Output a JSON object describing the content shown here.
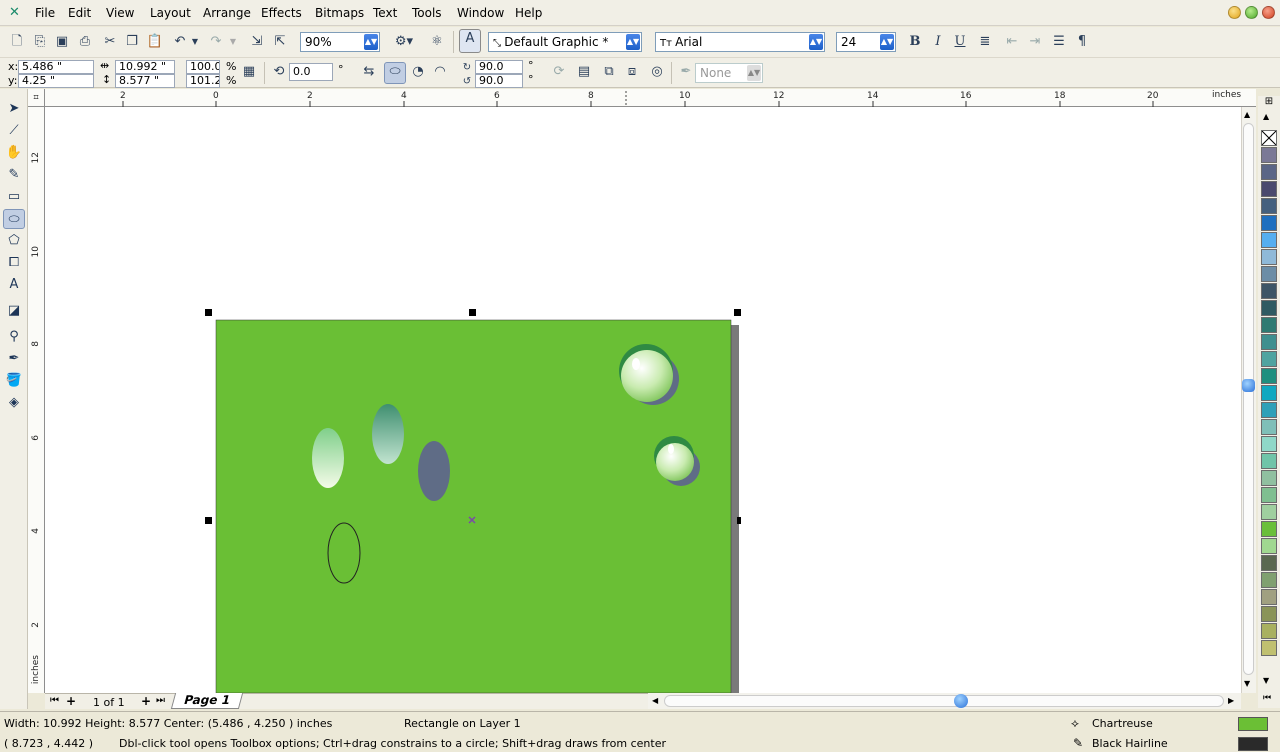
{
  "menu": [
    "File",
    "Edit",
    "View",
    "Layout",
    "Arrange",
    "Effects",
    "Bitmaps",
    "Text",
    "Tools",
    "Window",
    "Help"
  ],
  "toolbar": {
    "zoom": "90%",
    "style": "Default Graphic *",
    "font": "Arial",
    "font_size": "24",
    "bold": "B",
    "italic": "I",
    "underline": "U",
    "paragraph": "¶"
  },
  "propbar": {
    "x_label": "x:",
    "x_value": "5.486 \"",
    "y_label": "y:",
    "y_value": "4.25 \"",
    "width_value": "10.992 \"",
    "height_value": "8.577 \"",
    "scale_x": "100.0",
    "scale_y": "101.2",
    "percent": "%",
    "rotation": "0.0",
    "degree": "°",
    "start_angle": "90.0",
    "end_angle": "90.0",
    "outline": "None"
  },
  "ruler": {
    "unit": "inches",
    "top_ticks": [
      "2",
      "0",
      "2",
      "4",
      "6",
      "8",
      "10",
      "12",
      "14",
      "16",
      "18",
      "20"
    ],
    "left_ticks": [
      "12",
      "10",
      "8",
      "6",
      "4",
      "2"
    ],
    "left_unit": "inches"
  },
  "pagebar": {
    "count": "1 of 1",
    "page_tab": "Page 1"
  },
  "palette": [
    "#7b7996",
    "#5b6686",
    "#4b4a6e",
    "#45607e",
    "#1f6fbf",
    "#55aef0",
    "#8fb9d8",
    "#6c8da6",
    "#3e5566",
    "#2f5a62",
    "#2f7a72",
    "#3f8f8f",
    "#4fa4a0",
    "#1f8f7f",
    "#10a8c0",
    "#2fa0b8",
    "#7fbfb8",
    "#8fd8c8",
    "#70c4a8",
    "#90c0a0",
    "#7fbf90",
    "#9fcf9f",
    "#6abf3a",
    "#a0d890",
    "#5a6850",
    "#80a070",
    "#a0a080",
    "#8a9458",
    "#a8b060",
    "#c0c070"
  ],
  "status": {
    "dims": "Width: 10.992  Height: 8.577   Center: (5.486 , 4.250 )  inches",
    "object": "Rectangle on Layer 1",
    "cursor": "( 8.723 , 4.442 )",
    "hint": "Dbl-click tool opens Toolbox options; Ctrl+drag constrains to a circle; Shift+drag draws from center",
    "fill_name": "Chartreuse",
    "fill_color": "#6bbf35",
    "outline_name": "Black  Hairline",
    "outline_color": "#2a2a2a"
  },
  "colors": {
    "rect_fill": "#6abf35",
    "rect_shadow": "#808080",
    "ellipse_dark": "#5f6c86"
  }
}
